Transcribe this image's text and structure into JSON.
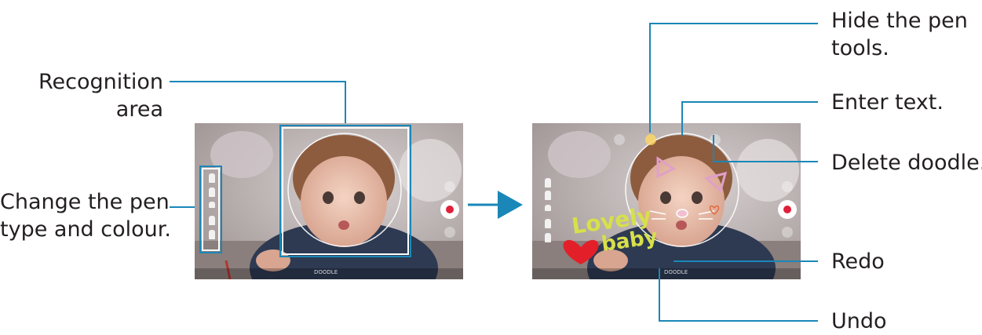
{
  "labels": {
    "recognition_area_line1": "Recognition",
    "recognition_area_line2": "area",
    "change_pen_line1": "Change the pen",
    "change_pen_line2": "type and colour.",
    "hide_pen_line1": "Hide the pen",
    "hide_pen_line2": "tools.",
    "enter_text": "Enter text.",
    "delete_doodle": "Delete doodle.",
    "redo": "Redo",
    "undo": "Undo"
  },
  "screens": {
    "doodle_text_line1": "Lovely",
    "doodle_text_line2": "baby",
    "mode_label": "DOODLE"
  },
  "colors": {
    "callout": "#1a87b8",
    "record_dot": "#e0203a",
    "doodle_text": "#d7e04a",
    "doodle_heart": "#e3202a",
    "doodle_ears": "#e0a0c8",
    "arrow": "#1a87b8"
  },
  "icons": [
    "record-icon",
    "settings-icon",
    "pen-icon",
    "text-icon",
    "delete-icon",
    "arrow-right-icon"
  ]
}
